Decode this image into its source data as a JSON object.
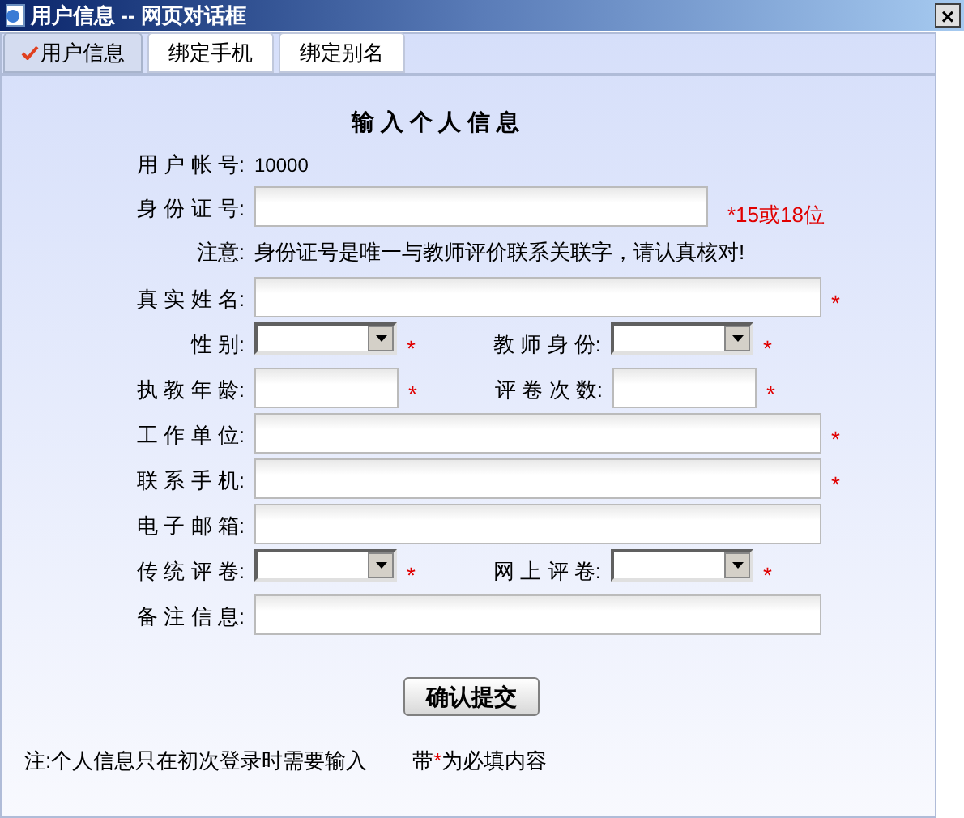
{
  "window": {
    "title": "用户信息 -- 网页对话框",
    "close": "×"
  },
  "tabs": [
    {
      "label": "用户信息",
      "selected": true
    },
    {
      "label": "绑定手机",
      "selected": false
    },
    {
      "label": "绑定别名",
      "selected": false
    }
  ],
  "heading": "输 入 个 人 信 息",
  "rows": [
    {
      "kind": "static",
      "label": "用 户 帐 号:",
      "value": "10000"
    },
    {
      "kind": "input",
      "label": "身 份 证 号:",
      "hint": "*15或18位"
    },
    {
      "kind": "note",
      "label": "注意:",
      "text": "身份证号是唯一与教师评价联系关联字，请认真核对!"
    },
    {
      "kind": "input",
      "label": "真 实 姓 名:",
      "mark": "*"
    },
    {
      "kind": "pair",
      "left": {
        "kind": "select",
        "label": "性 别:",
        "mark": "*"
      },
      "right": {
        "kind": "select",
        "label": "教 师 身 份:",
        "mark": "*"
      }
    },
    {
      "kind": "pair",
      "left": {
        "kind": "input",
        "label": "执 教 年 龄:",
        "mark": "*"
      },
      "right": {
        "kind": "input",
        "label": "评 卷 次 数:",
        "mark": "*"
      }
    },
    {
      "kind": "input",
      "label": "工 作 单 位:",
      "mark": "*"
    },
    {
      "kind": "input",
      "label": "联 系 手 机:",
      "mark": "*"
    },
    {
      "kind": "input",
      "label": "电 子 邮 箱:"
    },
    {
      "kind": "pair",
      "left": {
        "kind": "select",
        "label": "传 统 评 卷:",
        "mark": "*"
      },
      "right": {
        "kind": "select",
        "label": "网 上 评 卷:",
        "mark": "*"
      }
    },
    {
      "kind": "input",
      "label": "备 注 信 息:"
    }
  ],
  "submit": "确认提交",
  "footer": {
    "note": "注:个人信息只在初次登录时需要输入",
    "legend_before": "带",
    "legend_mark": "*",
    "legend_after": "为必填内容"
  }
}
